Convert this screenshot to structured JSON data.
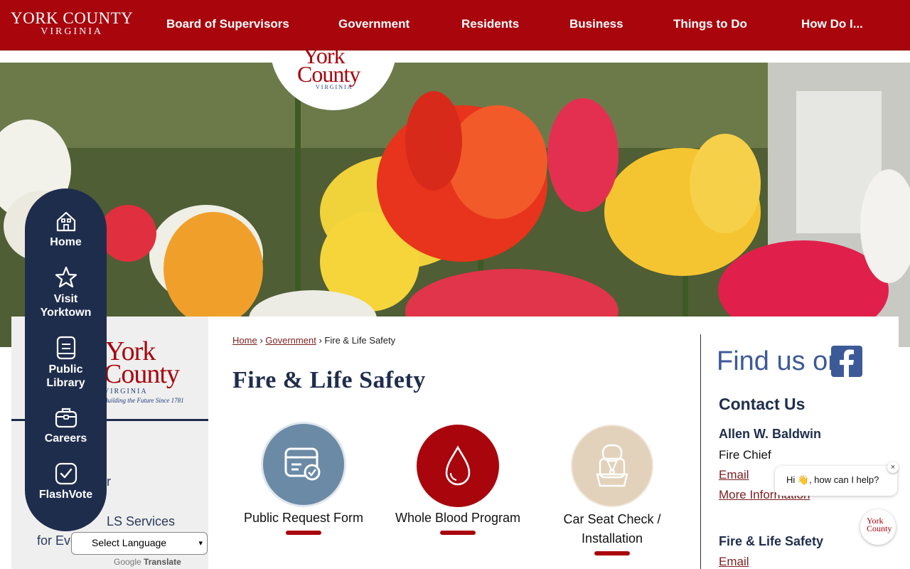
{
  "header": {
    "brand_line1": "YORK COUNTY",
    "brand_line2": "VIRGINIA",
    "nav": [
      "Board of Supervisors",
      "Government",
      "Residents",
      "Business",
      "Things to Do",
      "How Do I..."
    ]
  },
  "logo": {
    "line1": "York",
    "line2": "County",
    "line3": "VIRGINIA",
    "tagline": "Building the Future Since 1781"
  },
  "quicknav": [
    {
      "label": "Home",
      "icon": "house-icon"
    },
    {
      "label": "Visit Yorktown",
      "icon": "star-icon"
    },
    {
      "label": "Public Library",
      "icon": "book-icon"
    },
    {
      "label": "Careers",
      "icon": "briefcase-icon"
    },
    {
      "label": "FlashVote",
      "icon": "checkbox-icon"
    }
  ],
  "sidebar": {
    "link_partial_1": "er",
    "link_partial_2": "LS Services",
    "link_partial_3": "for Eve"
  },
  "language": {
    "select_label": "Select Language",
    "google": "Google",
    "translate": "Translate"
  },
  "breadcrumb": {
    "home": "Home",
    "government": "Government",
    "current": "Fire & Life Safety"
  },
  "page_title": "Fire & Life Safety",
  "tiles": [
    {
      "label": "Public Request Form",
      "color": "#6b8aa6",
      "icon": "form-check-icon"
    },
    {
      "label": "Whole Blood Program",
      "color": "#a8050d",
      "icon": "blood-drop-icon"
    },
    {
      "label_line1": "Car Seat Check /",
      "label_line2": "Installation",
      "color": "#e3d2bb",
      "icon": "car-seat-icon"
    }
  ],
  "right": {
    "facebook_text": "Find us on",
    "contact_heading": "Contact Us",
    "contact_name": "Allen W. Baldwin",
    "contact_role": "Fire Chief",
    "email": "Email",
    "more_info": "More Information",
    "section2_heading": "Fire & Life Safety",
    "section2_email": "Email"
  },
  "chat": {
    "greeting": "Hi 👋, how can I help?",
    "close": "×"
  },
  "colors": {
    "brand_red": "#a8050d",
    "navy": "#1f2d4d",
    "facebook_blue": "#3d5a98"
  }
}
